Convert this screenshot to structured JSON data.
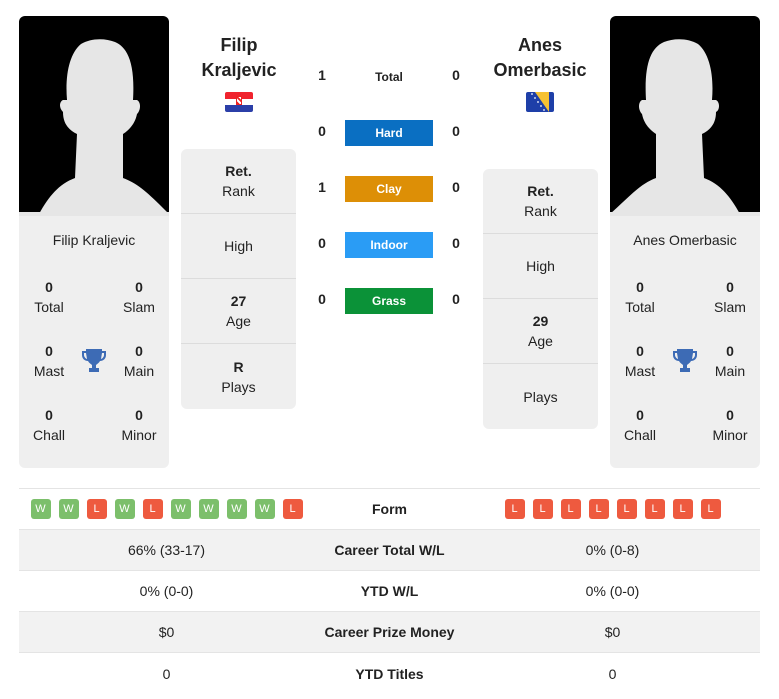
{
  "player1": {
    "first_name": "Filip",
    "last_name": "Kraljevic",
    "full_name": "Filip Kraljevic",
    "flag": "croatia-flag",
    "titles": {
      "total": {
        "value": "0",
        "label": "Total"
      },
      "slam": {
        "value": "0",
        "label": "Slam"
      },
      "mast": {
        "value": "0",
        "label": "Mast"
      },
      "main": {
        "value": "0",
        "label": "Main"
      },
      "chall": {
        "value": "0",
        "label": "Chall"
      },
      "minor": {
        "value": "0",
        "label": "Minor"
      }
    },
    "info": {
      "rank_value": "Ret.",
      "rank_label": "Rank",
      "high_value": "",
      "high_label": "High",
      "age_value": "27",
      "age_label": "Age",
      "plays_value": "R",
      "plays_label": "Plays"
    },
    "form": [
      "W",
      "W",
      "L",
      "W",
      "L",
      "W",
      "W",
      "W",
      "W",
      "L"
    ],
    "career_wl": "66% (33-17)",
    "ytd_wl": "0% (0-0)",
    "prize_money": "$0",
    "ytd_titles": "0"
  },
  "player2": {
    "first_name": "Anes",
    "last_name": "Omerbasic",
    "full_name": "Anes Omerbasic",
    "flag": "bosnia-flag",
    "titles": {
      "total": {
        "value": "0",
        "label": "Total"
      },
      "slam": {
        "value": "0",
        "label": "Slam"
      },
      "mast": {
        "value": "0",
        "label": "Mast"
      },
      "main": {
        "value": "0",
        "label": "Main"
      },
      "chall": {
        "value": "0",
        "label": "Chall"
      },
      "minor": {
        "value": "0",
        "label": "Minor"
      }
    },
    "info": {
      "rank_value": "Ret.",
      "rank_label": "Rank",
      "high_value": "",
      "high_label": "High",
      "age_value": "29",
      "age_label": "Age",
      "plays_value": "",
      "plays_label": "Plays"
    },
    "form": [
      "L",
      "L",
      "L",
      "L",
      "L",
      "L",
      "L",
      "L"
    ],
    "career_wl": "0% (0-8)",
    "ytd_wl": "0% (0-0)",
    "prize_money": "$0",
    "ytd_titles": "0"
  },
  "h2h": {
    "total": {
      "label": "Total",
      "p1": "1",
      "p2": "0"
    },
    "surfaces": [
      {
        "label": "Hard",
        "p1": "0",
        "p2": "0",
        "color": "#0a6fc2"
      },
      {
        "label": "Clay",
        "p1": "1",
        "p2": "0",
        "color": "#dd8f06"
      },
      {
        "label": "Indoor",
        "p1": "0",
        "p2": "0",
        "color": "#2a9cf5"
      },
      {
        "label": "Grass",
        "p1": "0",
        "p2": "0",
        "color": "#0b9238"
      }
    ]
  },
  "stats_labels": {
    "form": "Form",
    "career_wl": "Career Total W/L",
    "ytd_wl": "YTD W/L",
    "prize_money": "Career Prize Money",
    "ytd_titles": "YTD Titles"
  },
  "colors": {
    "win": "#7cbf6b",
    "loss": "#ee5a3f",
    "trophy": "#3d6bb5"
  }
}
